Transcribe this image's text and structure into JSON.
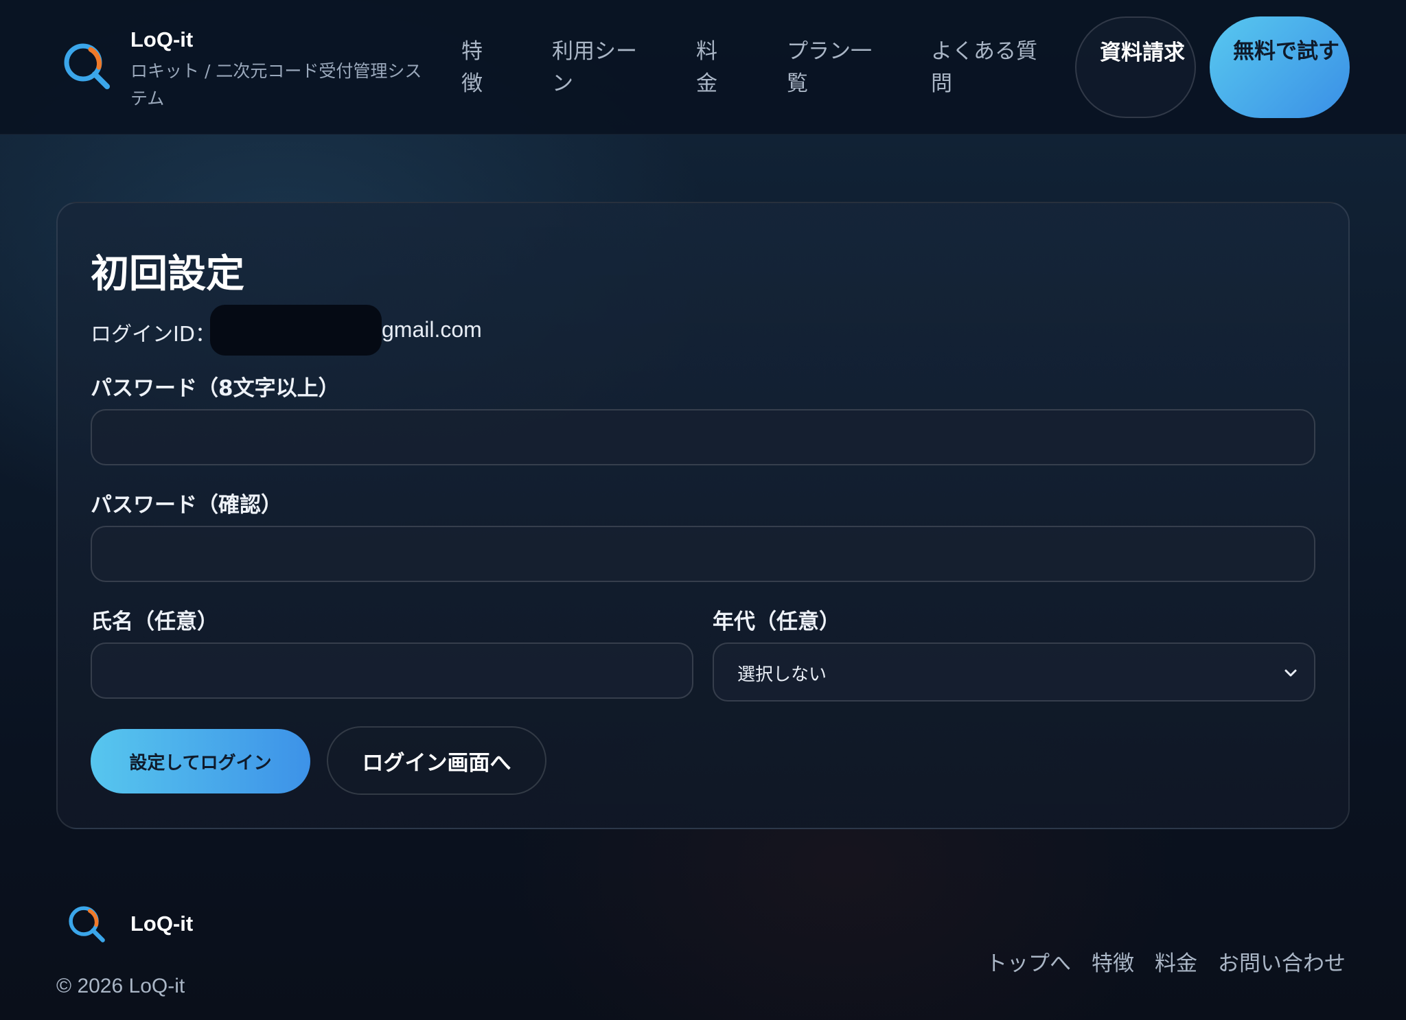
{
  "brand": {
    "name": "LoQ-it",
    "tagline": "ロキット / 二次元コード受付管理システム",
    "logo_icon": "magnifier-logo-icon",
    "colors": {
      "ring": "#3ba6ea",
      "accent": "#f07a2a"
    }
  },
  "nav": {
    "items": [
      {
        "label": "特徴"
      },
      {
        "label": "利用シーン"
      },
      {
        "label": "料金"
      },
      {
        "label": "プラン一覧"
      },
      {
        "label": "よくある質問"
      }
    ],
    "docs_button": "資料請求",
    "trial_button": "無料で試す"
  },
  "form": {
    "title": "初回設定",
    "login_id_label": "ログインID：",
    "login_id_domain": "gmail.com",
    "password_label": "パスワード（8文字以上）",
    "password_confirm_label": "パスワード（確認）",
    "name_label": "氏名（任意）",
    "age_label": "年代（任意）",
    "age_selected": "選択しない",
    "submit_button": "設定してログイン",
    "back_button": "ログイン画面へ"
  },
  "footer": {
    "name": "LoQ-it",
    "copyright": "© 2026 LoQ-it",
    "links": [
      {
        "label": "トップへ"
      },
      {
        "label": "特徴"
      },
      {
        "label": "料金"
      },
      {
        "label": "お問い合わせ"
      }
    ]
  },
  "colors": {
    "accent_gradient_start": "#57c6ee",
    "accent_gradient_end": "#3d92e8",
    "background": "#0a1220"
  }
}
